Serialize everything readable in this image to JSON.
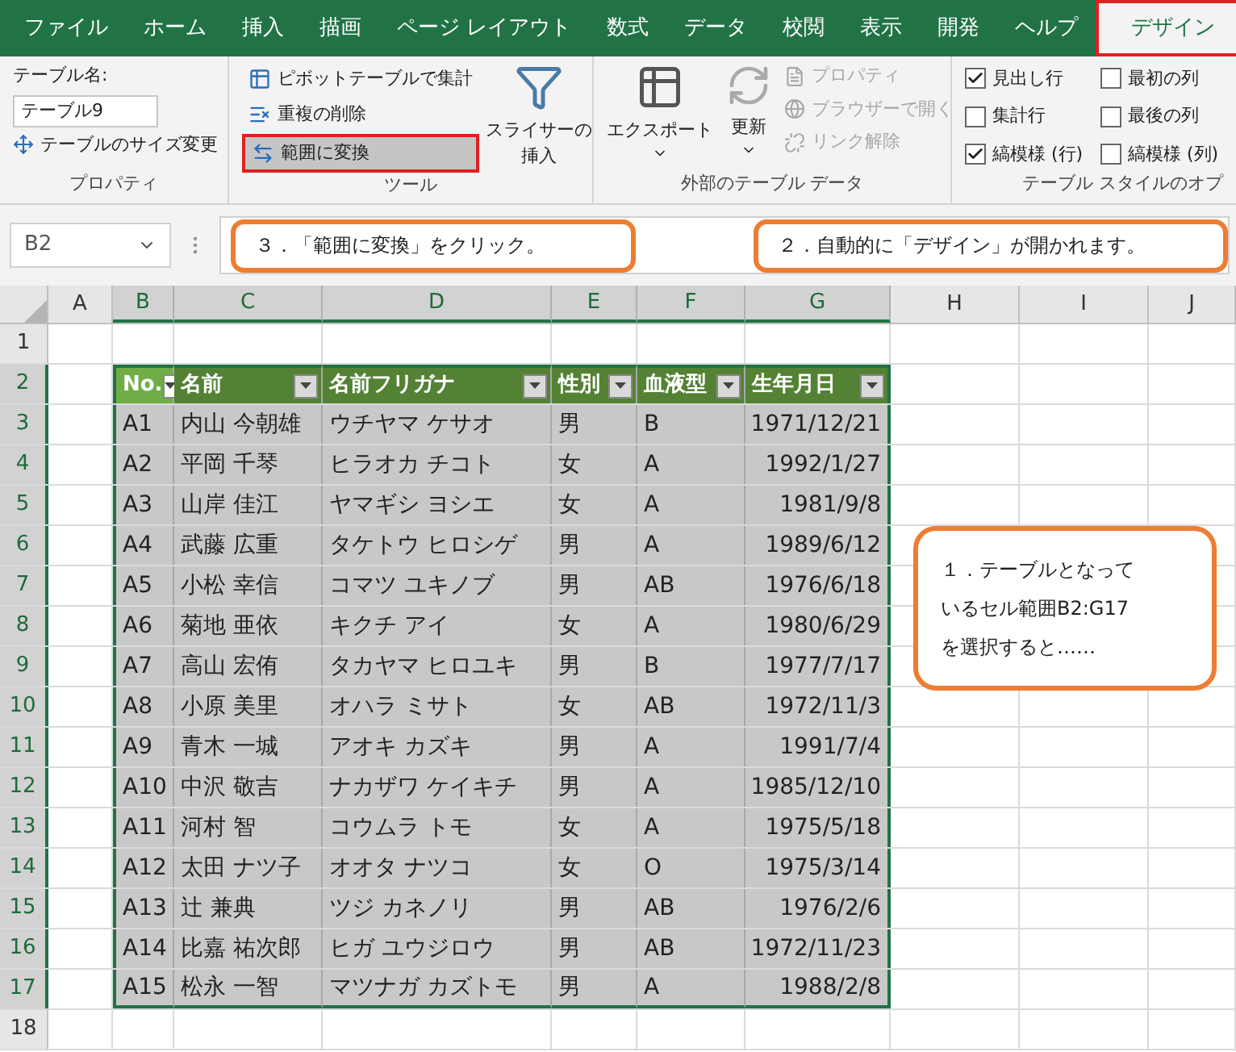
{
  "ribbon_tabs": [
    {
      "label": "ファイル",
      "selected": false
    },
    {
      "label": "ホーム",
      "selected": false
    },
    {
      "label": "挿入",
      "selected": false
    },
    {
      "label": "描画",
      "selected": false
    },
    {
      "label": "ページ レイアウト",
      "selected": false
    },
    {
      "label": "数式",
      "selected": false
    },
    {
      "label": "データ",
      "selected": false
    },
    {
      "label": "校閲",
      "selected": false
    },
    {
      "label": "表示",
      "selected": false
    },
    {
      "label": "開発",
      "selected": false
    },
    {
      "label": "ヘルプ",
      "selected": false
    },
    {
      "label": "デザイン",
      "selected": true
    }
  ],
  "properties_group": {
    "label": "プロパティ",
    "name_label": "テーブル名:",
    "name_value": "テーブル9",
    "resize_button": "テーブルのサイズ変更"
  },
  "tools_group": {
    "label": "ツール",
    "buttons": [
      {
        "label": "ピボットテーブルで集計",
        "highlighted": false
      },
      {
        "label": "重複の削除",
        "highlighted": false
      },
      {
        "label": "範囲に変換",
        "highlighted": true
      }
    ],
    "slicer_lines": [
      "スライサーの",
      "挿入"
    ]
  },
  "external_group": {
    "label": "外部のテーブル データ",
    "export_button": "エクスポート",
    "refresh_button": "更新",
    "links": [
      {
        "label": "プロパティ",
        "disabled": true
      },
      {
        "label": "ブラウザーで開く",
        "disabled": true
      },
      {
        "label": "リンク解除",
        "disabled": true
      }
    ]
  },
  "style_options_group": {
    "label": "テーブル スタイルのオプ",
    "options": [
      {
        "label": "見出し行",
        "checked": true
      },
      {
        "label": "集計行",
        "checked": false
      },
      {
        "label": "縞模様 (行)",
        "checked": true
      },
      {
        "label": "最初の列",
        "checked": false
      },
      {
        "label": "最後の列",
        "checked": false
      },
      {
        "label": "縞模様 (列)",
        "checked": false
      }
    ]
  },
  "name_box": "B2",
  "columns": [
    {
      "label": "A",
      "selected": false
    },
    {
      "label": "B",
      "selected": true
    },
    {
      "label": "C",
      "selected": true
    },
    {
      "label": "D",
      "selected": true
    },
    {
      "label": "E",
      "selected": true
    },
    {
      "label": "F",
      "selected": true
    },
    {
      "label": "G",
      "selected": true
    },
    {
      "label": "H",
      "selected": false
    },
    {
      "label": "I",
      "selected": false
    },
    {
      "label": "J",
      "selected": false
    }
  ],
  "row_numbers": [
    {
      "label": "1",
      "selected": false
    },
    {
      "label": "2",
      "selected": true
    },
    {
      "label": "3",
      "selected": true
    },
    {
      "label": "4",
      "selected": true
    },
    {
      "label": "5",
      "selected": true
    },
    {
      "label": "6",
      "selected": true
    },
    {
      "label": "7",
      "selected": true
    },
    {
      "label": "8",
      "selected": true
    },
    {
      "label": "9",
      "selected": true
    },
    {
      "label": "10",
      "selected": true
    },
    {
      "label": "11",
      "selected": true
    },
    {
      "label": "12",
      "selected": true
    },
    {
      "label": "13",
      "selected": true
    },
    {
      "label": "14",
      "selected": true
    },
    {
      "label": "15",
      "selected": true
    },
    {
      "label": "16",
      "selected": true
    },
    {
      "label": "17",
      "selected": true
    },
    {
      "label": "18",
      "selected": false
    }
  ],
  "table": {
    "headers": [
      "No.",
      "名前",
      "名前フリガナ",
      "性別",
      "血液型",
      "生年月日"
    ],
    "rows": [
      [
        "A1",
        "内山 今朝雄",
        "ウチヤマ ケサオ",
        "男",
        "B",
        "1971/12/21"
      ],
      [
        "A2",
        "平岡 千琴",
        "ヒラオカ チコト",
        "女",
        "A",
        "1992/1/27"
      ],
      [
        "A3",
        "山岸 佳江",
        "ヤマギシ ヨシエ",
        "女",
        "A",
        "1981/9/8"
      ],
      [
        "A4",
        "武藤 広重",
        "タケトウ ヒロシゲ",
        "男",
        "A",
        "1989/6/12"
      ],
      [
        "A5",
        "小松 幸信",
        "コマツ ユキノブ",
        "男",
        "AB",
        "1976/6/18"
      ],
      [
        "A6",
        "菊地 亜依",
        "キクチ アイ",
        "女",
        "A",
        "1980/6/29"
      ],
      [
        "A7",
        "高山 宏侑",
        "タカヤマ ヒロユキ",
        "男",
        "B",
        "1977/7/17"
      ],
      [
        "A8",
        "小原 美里",
        "オハラ ミサト",
        "女",
        "AB",
        "1972/11/3"
      ],
      [
        "A9",
        "青木 一城",
        "アオキ カズキ",
        "男",
        "A",
        "1991/7/4"
      ],
      [
        "A10",
        "中沢 敬吉",
        "ナカザワ ケイキチ",
        "男",
        "A",
        "1985/12/10"
      ],
      [
        "A11",
        "河村 智",
        "コウムラ トモ",
        "女",
        "A",
        "1975/5/18"
      ],
      [
        "A12",
        "太田 ナツ子",
        "オオタ ナツコ",
        "女",
        "O",
        "1975/3/14"
      ],
      [
        "A13",
        "辻 兼典",
        "ツジ カネノリ",
        "男",
        "AB",
        "1976/2/6"
      ],
      [
        "A14",
        "比嘉 祐次郎",
        "ヒガ ユウジロウ",
        "男",
        "AB",
        "1972/11/23"
      ],
      [
        "A15",
        "松永 一智",
        "マツナガ カズトモ",
        "男",
        "A",
        "1988/2/8"
      ]
    ]
  },
  "callouts": [
    {
      "text": "３．「範囲に変換」をクリック。"
    },
    {
      "text": "２．自動的に「デザイン」が開かれます。"
    },
    {
      "text": "１．テーブルとなっているセル範囲B2:G17を選択すると……"
    }
  ]
}
